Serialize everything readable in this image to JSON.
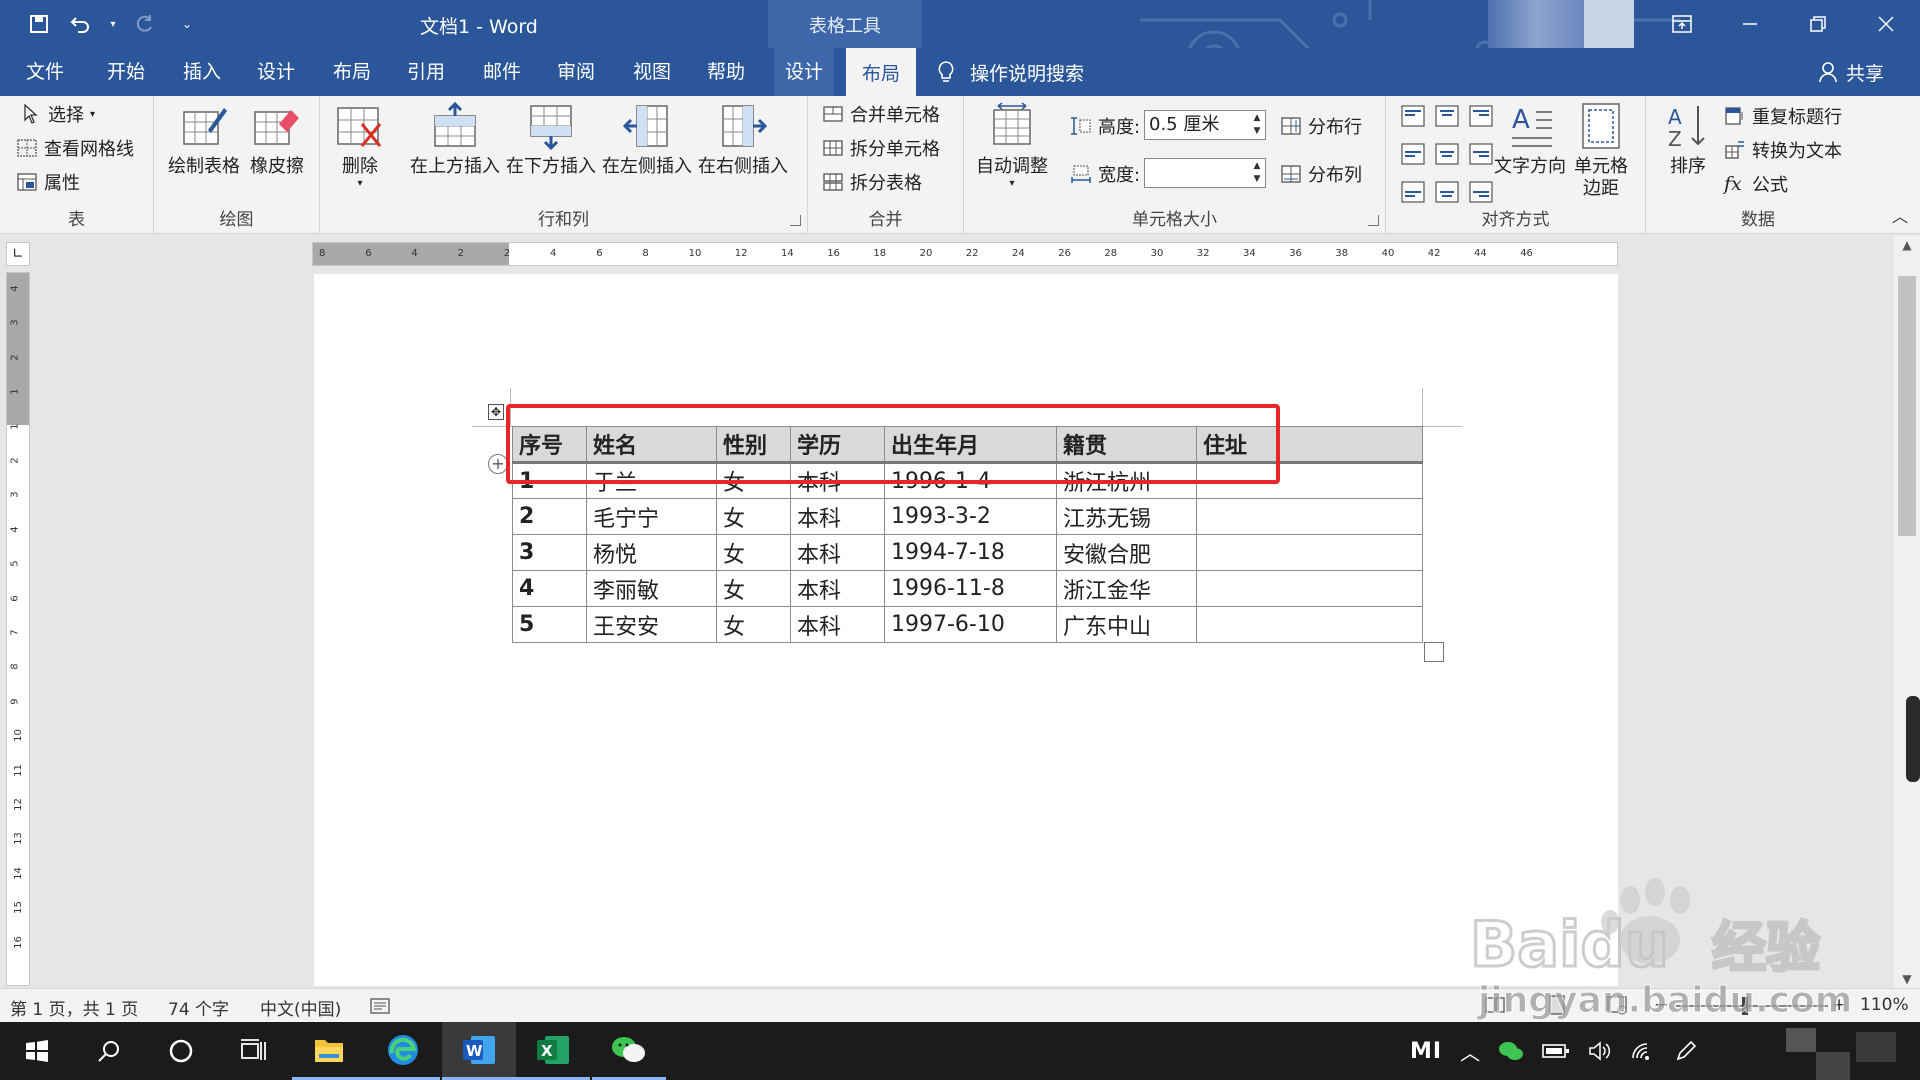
{
  "titlebar": {
    "doc_title": "文档1  -  Word",
    "context_tab": "表格工具"
  },
  "menu": {
    "tabs": [
      "文件",
      "开始",
      "插入",
      "设计",
      "布局",
      "引用",
      "邮件",
      "审阅",
      "视图",
      "帮助",
      "设计",
      "布局"
    ],
    "active_index": 11,
    "search_label": "操作说明搜索",
    "share_label": "共享"
  },
  "ribbon": {
    "table": {
      "name": "表",
      "select": "选择",
      "gridlines": "查看网格线",
      "properties": "属性"
    },
    "draw": {
      "name": "绘图",
      "draw_table": "绘制表格",
      "eraser": "橡皮擦"
    },
    "rows_cols": {
      "name": "行和列",
      "delete": "删除",
      "insert_above": "在上方插入",
      "insert_below": "在下方插入",
      "insert_left": "在左侧插入",
      "insert_right": "在右侧插入"
    },
    "merge": {
      "name": "合并",
      "merge_cells": "合并单元格",
      "split_cells": "拆分单元格",
      "split_table": "拆分表格"
    },
    "cell_size": {
      "name": "单元格大小",
      "autofit": "自动调整",
      "height_label": "高度:",
      "height_value": "0.5 厘米",
      "width_label": "宽度:",
      "width_value": "",
      "dist_rows": "分布行",
      "dist_cols": "分布列"
    },
    "alignment": {
      "name": "对齐方式",
      "text_direction": "文字方向",
      "cell_margins_1": "单元格",
      "cell_margins_2": "边距"
    },
    "data": {
      "name": "数据",
      "sort": "排序",
      "repeat_header": "重复标题行",
      "to_text": "转换为文本",
      "formula": "公式",
      "fx": "fx"
    }
  },
  "ruler": {
    "top_labels": [
      "8",
      "6",
      "4",
      "2",
      "2",
      "4",
      "6",
      "8",
      "10",
      "12",
      "14",
      "16",
      "18",
      "20",
      "22",
      "24",
      "26",
      "28",
      "30",
      "32",
      "34",
      "36",
      "38",
      "40",
      "42",
      "44",
      "46"
    ],
    "left_labels": [
      "4",
      "3",
      "2",
      "1",
      "1",
      "2",
      "3",
      "4",
      "5",
      "6",
      "7",
      "8",
      "9",
      "10",
      "11",
      "12",
      "13",
      "14",
      "15",
      "16"
    ]
  },
  "table": {
    "headers": [
      "序号",
      "姓名",
      "性别",
      "学历",
      "出生年月",
      "籍贯",
      "住址"
    ],
    "rows": [
      [
        "1",
        "于兰",
        "女",
        "本科",
        "1996-1-4",
        "浙江杭州",
        ""
      ],
      [
        "2",
        "毛宁宁",
        "女",
        "本科",
        "1993-3-2",
        "江苏无锡",
        ""
      ],
      [
        "3",
        "杨悦",
        "女",
        "本科",
        "1994-7-18",
        "安徽合肥",
        ""
      ],
      [
        "4",
        "李丽敏",
        "女",
        "本科",
        "1996-11-8",
        "浙江金华",
        ""
      ],
      [
        "5",
        "王安安",
        "女",
        "本科",
        "1997-6-10",
        "广东中山",
        ""
      ]
    ]
  },
  "status": {
    "page": "第 1 页，共 1 页",
    "words": "74 个字",
    "language": "中文(中国)",
    "zoom": "110%"
  },
  "watermark": {
    "brand": "Baidu",
    "cn": "经验",
    "url": "jingyan.baidu.com"
  },
  "tray": {
    "mi": "MI"
  },
  "colors": {
    "accent": "#2b579a",
    "highlight": "#e8262a"
  }
}
